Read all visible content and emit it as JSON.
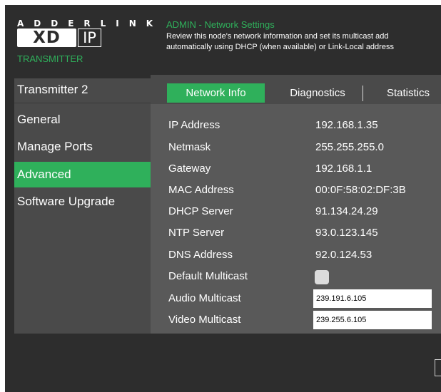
{
  "brand": {
    "wordmark": "ADDERLINK",
    "logo_xd": "XD",
    "logo_ip": "IP",
    "device_type": "TRANSMITTER"
  },
  "header": {
    "title": "ADMIN - Network Settings",
    "description_line1": "Review this node's network information and set its multicast add",
    "description_line2": "automatically using DHCP (when available) or Link-Local address"
  },
  "sidebar": {
    "node_name": "Transmitter 2",
    "items": [
      {
        "label": "General",
        "active": false
      },
      {
        "label": "Manage Ports",
        "active": false
      },
      {
        "label": "Advanced",
        "active": true
      },
      {
        "label": "Software Upgrade",
        "active": false
      }
    ]
  },
  "tabs": [
    {
      "label": "Network Info",
      "active": true
    },
    {
      "label": "Diagnostics",
      "active": false
    },
    {
      "label": "Statistics",
      "active": false
    }
  ],
  "network_info": {
    "ip_address": {
      "label": "IP Address",
      "value": "192.168.1.35"
    },
    "netmask": {
      "label": "Netmask",
      "value": "255.255.255.0"
    },
    "gateway": {
      "label": "Gateway",
      "value": "192.168.1.1"
    },
    "mac_address": {
      "label": "MAC Address",
      "value": "00:0F:58:02:DF:3B"
    },
    "dhcp_server": {
      "label": "DHCP Server",
      "value": "91.134.24.29"
    },
    "ntp_server": {
      "label": "NTP Server",
      "value": "93.0.123.145"
    },
    "dns_address": {
      "label": "DNS Address",
      "value": "92.0.124.53"
    },
    "default_multicast": {
      "label": "Default Multicast",
      "checked": false
    },
    "audio_multicast": {
      "label": "Audio Multicast",
      "value": "239.191.6.105"
    },
    "video_multicast": {
      "label": "Video Multicast",
      "value": "239.255.6.105"
    }
  },
  "colors": {
    "accent": "#2fb05b",
    "background": "#2d2d2d",
    "sidebar": "#4a4a4a",
    "panel": "#595959"
  }
}
